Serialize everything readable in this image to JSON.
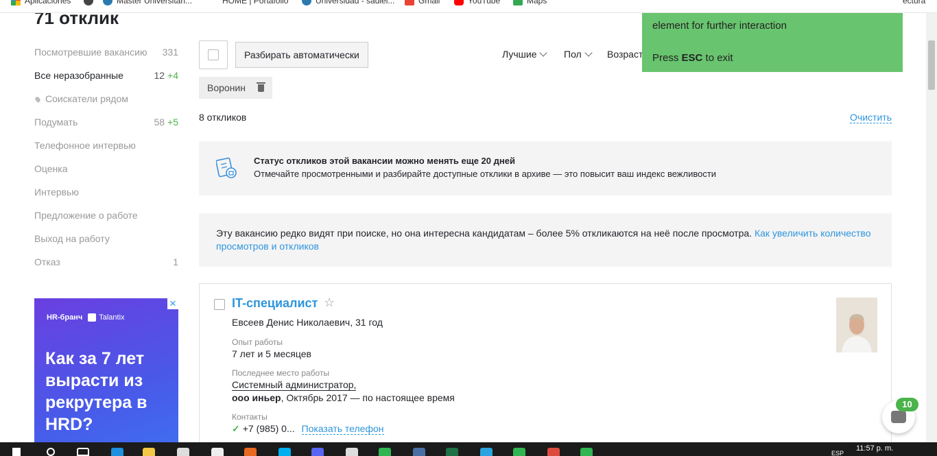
{
  "bookmarks": [
    {
      "label": "Aplicaciones",
      "icon": "apps-grid-icon",
      "color": "#ea4335"
    },
    {
      "label": "Master Universitari...",
      "icon": "globe-icon",
      "color": "#444444"
    },
    {
      "label": "HOME | Portafolio",
      "icon": "",
      "color": ""
    },
    {
      "label": "Universidad - sadiel...",
      "icon": "globe-icon",
      "color": "#2a7ab0"
    },
    {
      "label": "Gmail",
      "icon": "gmail-icon",
      "color": "#ea4335"
    },
    {
      "label": "YouTube",
      "icon": "youtube-icon",
      "color": "#ff0000"
    },
    {
      "label": "Maps",
      "icon": "maps-icon",
      "color": "#34a853"
    },
    {
      "label": "ectura",
      "icon": "",
      "color": ""
    }
  ],
  "page": {
    "title": "71 отклик"
  },
  "sidebar": {
    "items": [
      {
        "label": "Посмотревшие вакансию",
        "count": "331",
        "plus": ""
      },
      {
        "label": "Все неразобранные",
        "count": "12",
        "plus": "+4"
      },
      {
        "label": "Соискатели рядом",
        "count": "",
        "plus": ""
      },
      {
        "label": "Подумать",
        "count": "58",
        "plus": "+5"
      },
      {
        "label": "Телефонное интервью",
        "count": "",
        "plus": ""
      },
      {
        "label": "Оценка",
        "count": "",
        "plus": ""
      },
      {
        "label": "Интервью",
        "count": "",
        "plus": ""
      },
      {
        "label": "Предложение о работе",
        "count": "",
        "plus": ""
      },
      {
        "label": "Выход на работу",
        "count": "",
        "plus": ""
      },
      {
        "label": "Отказ",
        "count": "1",
        "plus": ""
      }
    ]
  },
  "ad": {
    "close": "✕",
    "brand": "HR-бранч",
    "partner": "Talantix",
    "headline": "Как за 7 лет вырасти из рекрутера в HRD?"
  },
  "toolbar": {
    "auto_button": "Разбирать автоматически",
    "sort_best": "Лучшие",
    "sort_gender": "Пол",
    "sort_age": "Возраст"
  },
  "filter_tag": {
    "label": "Воронин"
  },
  "results": {
    "count_text": "8 откликов",
    "clear_link": "Очистить"
  },
  "status_banner": {
    "title": "Статус откликов этой вакансии можно менять еще 20 дней",
    "text": "Отмечайте просмотренными и разбирайте доступные отклики в архиве — это повысит ваш индекс вежливости"
  },
  "info_banner": {
    "text": "Эту вакансию редко видят при поиске, но она интересна кандидатам – более 5% откликаются на неё после просмотра.",
    "link": "Как увеличить количество просмотров и откликов"
  },
  "candidate": {
    "title": "IT-специалист",
    "star": "☆",
    "name": "Евсеев Денис Николаевич, 31 год",
    "experience_label": "Опыт работы",
    "experience_value": "7 лет и 5 месяцев",
    "last_job_label": "Последнее место работы",
    "last_job_position": "Системный администратор,",
    "last_job_company": "ооо иньер",
    "last_job_period": ", Октябрь 2017 — по настоящее время",
    "contacts_label": "Контакты",
    "phone": "+7 (985) 0...",
    "show_phone": "Показать телефон"
  },
  "toast": {
    "line1": "element for further interaction",
    "press": "Press",
    "key": "ESC",
    "to_exit": "to exit"
  },
  "chat": {
    "badge": "10"
  },
  "taskbar": {
    "time": "11:57 p. m.",
    "lang": "ESP"
  },
  "colors": {
    "link": "#2e95dc",
    "green": "#4bb34b",
    "toast": "#68c46e",
    "ad_gradient_start": "#6a3fe0"
  }
}
